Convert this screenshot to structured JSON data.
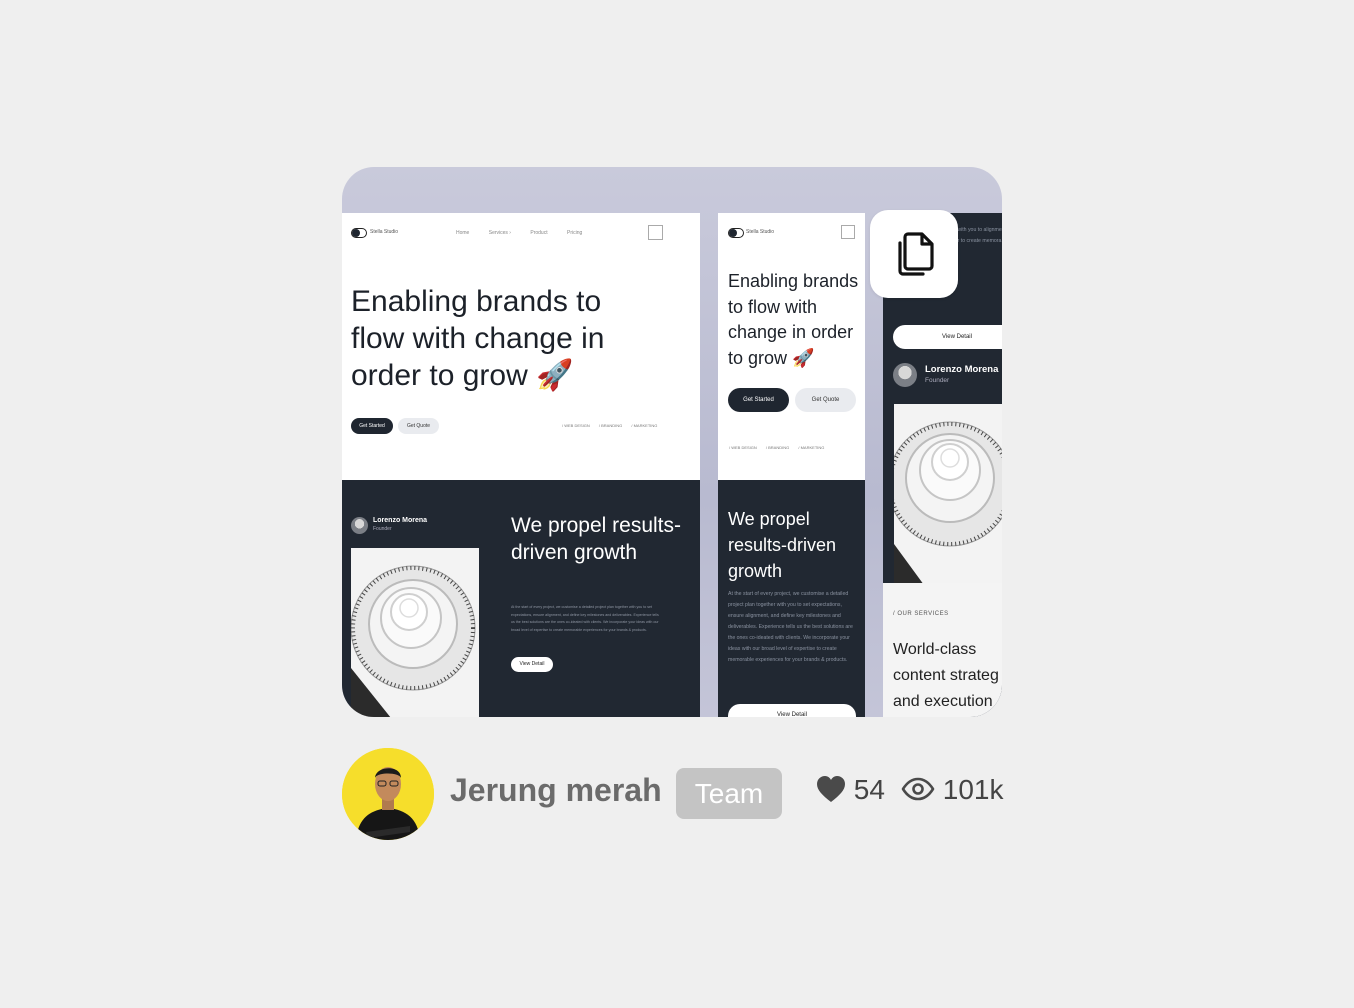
{
  "preview": {
    "desktop": {
      "brand": "Stella Studio",
      "nav": [
        "Home",
        "Services ›",
        "Product",
        "Pricing"
      ],
      "hero_title": "Enabling brands to flow with change in order to grow 🚀",
      "btn_primary": "Get Started",
      "btn_secondary": "Get Quote",
      "tags": [
        "/ WEB DESIGN",
        "/ BRANDING",
        "/ MARKETING"
      ],
      "person_name": "Lorenzo Morena",
      "person_role": "Founder",
      "section_title": "We propel results-driven growth",
      "section_body": "At the start of every project, we customise a detailed project plan together with you to set expectations, ensure alignment, and define key milestones and deliverables. Experience tells us the best solutions are the ones co-ideated with clients. We incorporate your ideas with our broad level of expertise to create memorable experiences for your brands & products.",
      "view_detail": "View Detail"
    },
    "mobile": {
      "brand": "Stella Studio",
      "hero_title": "Enabling brands to flow with change in order to grow 🚀",
      "btn_primary": "Get Started",
      "btn_secondary": "Get Quote",
      "tags": [
        "/ WEB DESIGN",
        "/ BRANDING",
        "/ MARKETING"
      ],
      "section_title": "We propel results-driven growth",
      "section_body": "At the start of every project, we customise a detailed project plan together with you to set expectations, ensure alignment, and define key milestones and deliverables. Experience tells us the best solutions are the ones co-ideated with clients. We incorporate your ideas with our broad level of expertise to create memorable experiences for your brands & products.",
      "view_detail": "View Detail"
    },
    "strip": {
      "body_fragment": "ject, we customise together with you to alignment, and define les. Experience t ones co-ideate your ideas with our to create memora experiences for your brands & products.",
      "view_detail": "View Detail",
      "person_name": "Lorenzo Morena",
      "person_role": "Founder",
      "services_label": "/ OUR SERVICES",
      "services_title": "World-class content strateg and execution"
    },
    "copy_icon": "copy-icon"
  },
  "author": {
    "name": "Jerung merah",
    "badge": "Team",
    "avatar_bg": "#f6de2b"
  },
  "stats": {
    "likes": "54",
    "views": "101k",
    "like_icon": "heart-icon",
    "view_icon": "eye-icon"
  }
}
